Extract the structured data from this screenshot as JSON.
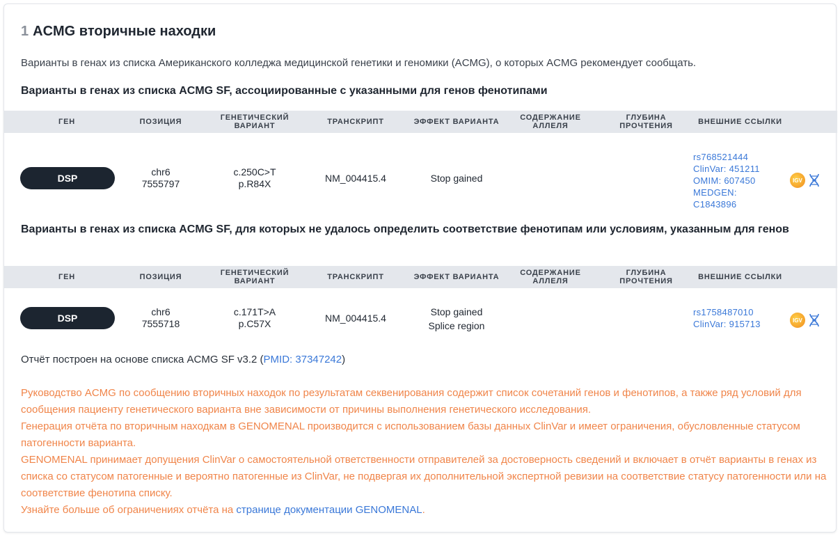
{
  "section": {
    "number": "1",
    "title": "ACMG вторичные находки",
    "intro": "Варианты в генах из списка Американского колледжа медицинской генетики и геномики (ACMG), о которых ACMG рекомендует сообщать."
  },
  "table_headers": {
    "gene": "ГЕН",
    "position": "ПОЗИЦИЯ",
    "variant_1": "ГЕНЕТИЧЕСКИЙ",
    "variant_2": "ВАРИАНТ",
    "transcript": "ТРАНСКРИПТ",
    "effect": "ЭФФЕКТ ВАРИАНТА",
    "allele_1": "СОДЕРЖАНИЕ",
    "allele_2": "АЛЛЕЛЯ",
    "depth_1": "ГЛУБИНА",
    "depth_2": "ПРОЧТЕНИЯ",
    "links": "ВНЕШНИЕ ССЫЛКИ"
  },
  "group1": {
    "title": "Варианты в генах из списка ACMG SF, ассоциированные с указанными для генов фенотипами",
    "row": {
      "gene": "DSP",
      "chr": "chr6",
      "pos": "7555797",
      "hgvs_c": "c.250C>T",
      "hgvs_p": "p.R84X",
      "transcript": "NM_004415.4",
      "effect_1": "Stop gained",
      "effect_2": "",
      "links": [
        "rs768521444",
        "ClinVar: 451211",
        "OMIM: 607450",
        "MEDGEN:",
        "C1843896"
      ]
    }
  },
  "group2": {
    "title": "Варианты в генах из списка ACMG SF, для которых не удалось определить соответствие фенотипам или условиям, указанным для генов",
    "row": {
      "gene": "DSP",
      "chr": "chr6",
      "pos": "7555718",
      "hgvs_c": "c.171T>A",
      "hgvs_p": "p.C57X",
      "transcript": "NM_004415.4",
      "effect_1": "Stop gained",
      "effect_2": "Splice region",
      "links": [
        "rs1758487010",
        "ClinVar: 915713"
      ]
    }
  },
  "footer": {
    "prefix": "Отчёт построен на основе списка ACMG SF v3.2 (",
    "pmid": "PMID: 37347242",
    "suffix": ")"
  },
  "warning": {
    "p1": "Руководство ACMG по сообщению вторичных находок по результатам секвенирования содержит список сочетаний генов и фенотипов, а также ряд условий для сообщения пациенту генетического варианта вне зависимости от причины выполнения генетического исследования.",
    "p2": "Генерация отчёта по вторичным находкам в GENOMENAL производится с использованием базы данных ClinVar и имеет ограничения, обусловленные статусом патогенности варианта.",
    "p3": "GENOMENAL принимает допущения ClinVar о самостоятельной ответственности отправителей за достоверность сведений и включает в отчёт варианты в генах из списка со статусом патогенные и вероятно патогенные из ClinVar, не подвергая их дополнительной экспертной ревизии на соответствие статусу патогенности или на соответствие фенотипа списку.",
    "p4_prefix": "Узнайте больше об ограничениях отчёта на ",
    "p4_link": "странице документации GENOMENAL",
    "p4_suffix": "."
  },
  "icons": {
    "igv": "igv-icon",
    "igv_label": "IGV",
    "dna": "dna-icon"
  },
  "colors": {
    "pill": "#1c2530",
    "link": "#3a78d8",
    "warning": "#f0854a",
    "header_bg": "#e4e7ec"
  }
}
